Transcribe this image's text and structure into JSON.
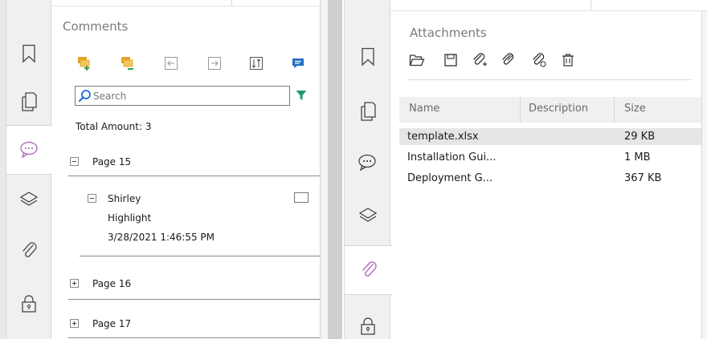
{
  "left_panel": {
    "title": "Comments",
    "search": {
      "placeholder": "Search",
      "value": ""
    },
    "total_amount": "Total Amount: 3",
    "pages": [
      {
        "label": "Page 15",
        "expanded": true,
        "comments": [
          {
            "author": "Shirley",
            "type": "Highlight",
            "date": "3/28/2021 1:46:55 PM"
          }
        ]
      },
      {
        "label": "Page 16",
        "expanded": false
      },
      {
        "label": "Page 17",
        "expanded": false
      }
    ],
    "toolbar_icons": [
      "expand-all-icon",
      "collapse-all-icon",
      "import-comments-icon",
      "export-comments-icon",
      "sort-icon",
      "comment-icon"
    ],
    "rail_icons": [
      "bookmark-icon",
      "pages-icon",
      "comments-icon",
      "layers-icon",
      "attachments-icon",
      "security-icon"
    ],
    "active_rail": "comments-icon"
  },
  "right_panel": {
    "title": "Attachments",
    "toolbar_icons": [
      "open-icon",
      "save-icon",
      "add-attachment-icon",
      "add-files-icon",
      "edit-attachment-icon",
      "delete-icon"
    ],
    "columns": [
      "Name",
      "Description",
      "Size"
    ],
    "rows": [
      {
        "name": "template.xlsx",
        "description": "",
        "size": "29 KB"
      },
      {
        "name": "Installation Gui...",
        "description": "",
        "size": "1 MB"
      },
      {
        "name": "Deployment G...",
        "description": "",
        "size": "367 KB"
      }
    ],
    "rail_icons": [
      "bookmark-icon",
      "pages-icon",
      "comments-icon",
      "layers-icon",
      "attachments-icon",
      "security-icon"
    ],
    "active_rail": "attachments-icon"
  },
  "colors": {
    "accent_purple": "#b36fbf",
    "toolbar_orange": "#e5a52a",
    "toolbar_green": "#3d9a4f",
    "filter_teal": "#1e9a72",
    "comment_blue": "#1f6fc5",
    "search_blue": "#1e6cd4"
  }
}
